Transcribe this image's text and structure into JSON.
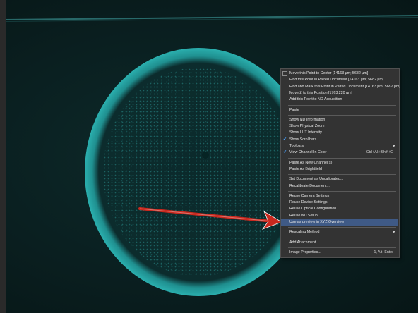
{
  "menu": {
    "items": [
      {
        "label": "Move this Point to Center [14163 µm; 5682 µm]",
        "icon": "crosshair-icon"
      },
      {
        "label": "Find this Point in Paired Document [14163 µm; 5682 µm]"
      },
      {
        "label": "Find and Mark this Point in Paired Document [14163 µm; 5682 µm]"
      },
      {
        "label": "Move Z to this Position [1763.220 µm]"
      },
      {
        "label": "Add this Point to ND Acquisition"
      },
      {
        "separator": true
      },
      {
        "label": "Paste"
      },
      {
        "separator": true
      },
      {
        "label": "Show ND Information"
      },
      {
        "label": "Show Physical Zoom"
      },
      {
        "label": "Show LUT Intensity"
      },
      {
        "label": "Show Scrollbars",
        "checked": true
      },
      {
        "label": "Toolbars",
        "submenu": true
      },
      {
        "label": "View Channel In Color",
        "checked": true,
        "shortcut": "Ctrl+Alt+Shift+C"
      },
      {
        "separator": true
      },
      {
        "label": "Paste As New Channel(s)"
      },
      {
        "label": "Paste As Brightfield"
      },
      {
        "separator": true
      },
      {
        "label": "Set Document as Uncalibrated..."
      },
      {
        "label": "Recalibrate Document..."
      },
      {
        "separator": true
      },
      {
        "label": "Reuse Camera Settings"
      },
      {
        "label": "Reuse Device Settings"
      },
      {
        "label": "Reuse Optical Configuration"
      },
      {
        "label": "Reuse ND Setup"
      },
      {
        "label": "Use as preview in XYZ Overview",
        "highlighted": true
      },
      {
        "separator": true
      },
      {
        "label": "Rescaling Method",
        "submenu": true
      },
      {
        "separator": true
      },
      {
        "label": "Add Attachment..."
      },
      {
        "separator": true
      },
      {
        "label": "Image Properties...",
        "shortcut": "1, Alt+Enter"
      }
    ]
  },
  "colors": {
    "accent_cyan": "#33c6c4",
    "arrow_red": "#c8281e",
    "menu_bg": "#333333",
    "highlight": "#3f5a86",
    "check": "#4aa3ff"
  }
}
